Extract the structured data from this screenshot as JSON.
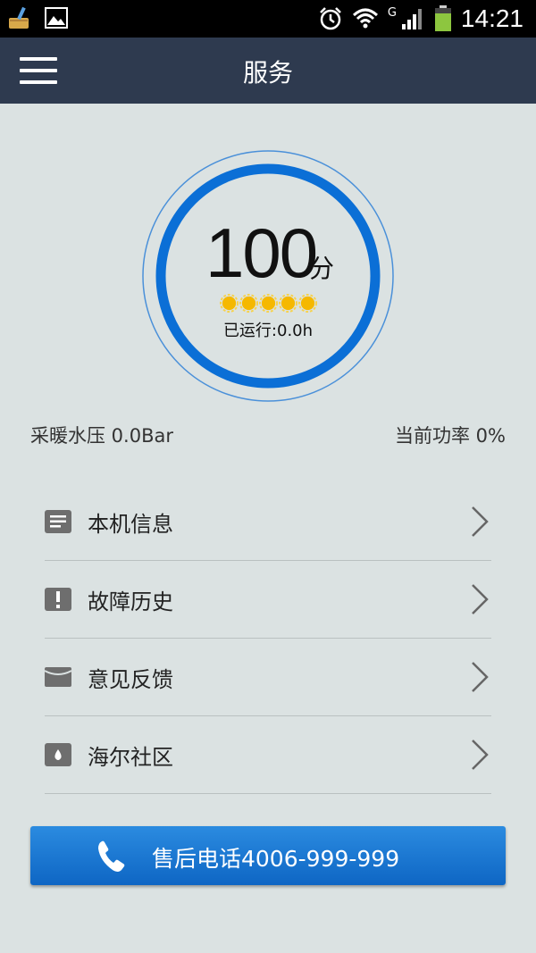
{
  "status_bar": {
    "time": "14:21",
    "network_type": "G",
    "icons": [
      "broom-icon",
      "gallery-icon",
      "alarm-icon",
      "wifi-icon",
      "signal-icon",
      "battery-icon"
    ]
  },
  "header": {
    "title": "服务"
  },
  "score": {
    "value": "100",
    "unit": "分",
    "stars_filled": 5,
    "stars_total": 5,
    "runtime_label": "已运行:0.0h",
    "ring_color": "#0b6fd6"
  },
  "stats": {
    "left": "采暖水压 0.0Bar",
    "right": "当前功率 0%"
  },
  "menu": [
    {
      "label": "本机信息",
      "icon": "list-icon"
    },
    {
      "label": "故障历史",
      "icon": "warning-icon"
    },
    {
      "label": "意见反馈",
      "icon": "envelope-icon"
    },
    {
      "label": "海尔社区",
      "icon": "community-icon"
    }
  ],
  "call_button": {
    "label": "售后电话4006-999-999",
    "icon": "phone-icon"
  }
}
